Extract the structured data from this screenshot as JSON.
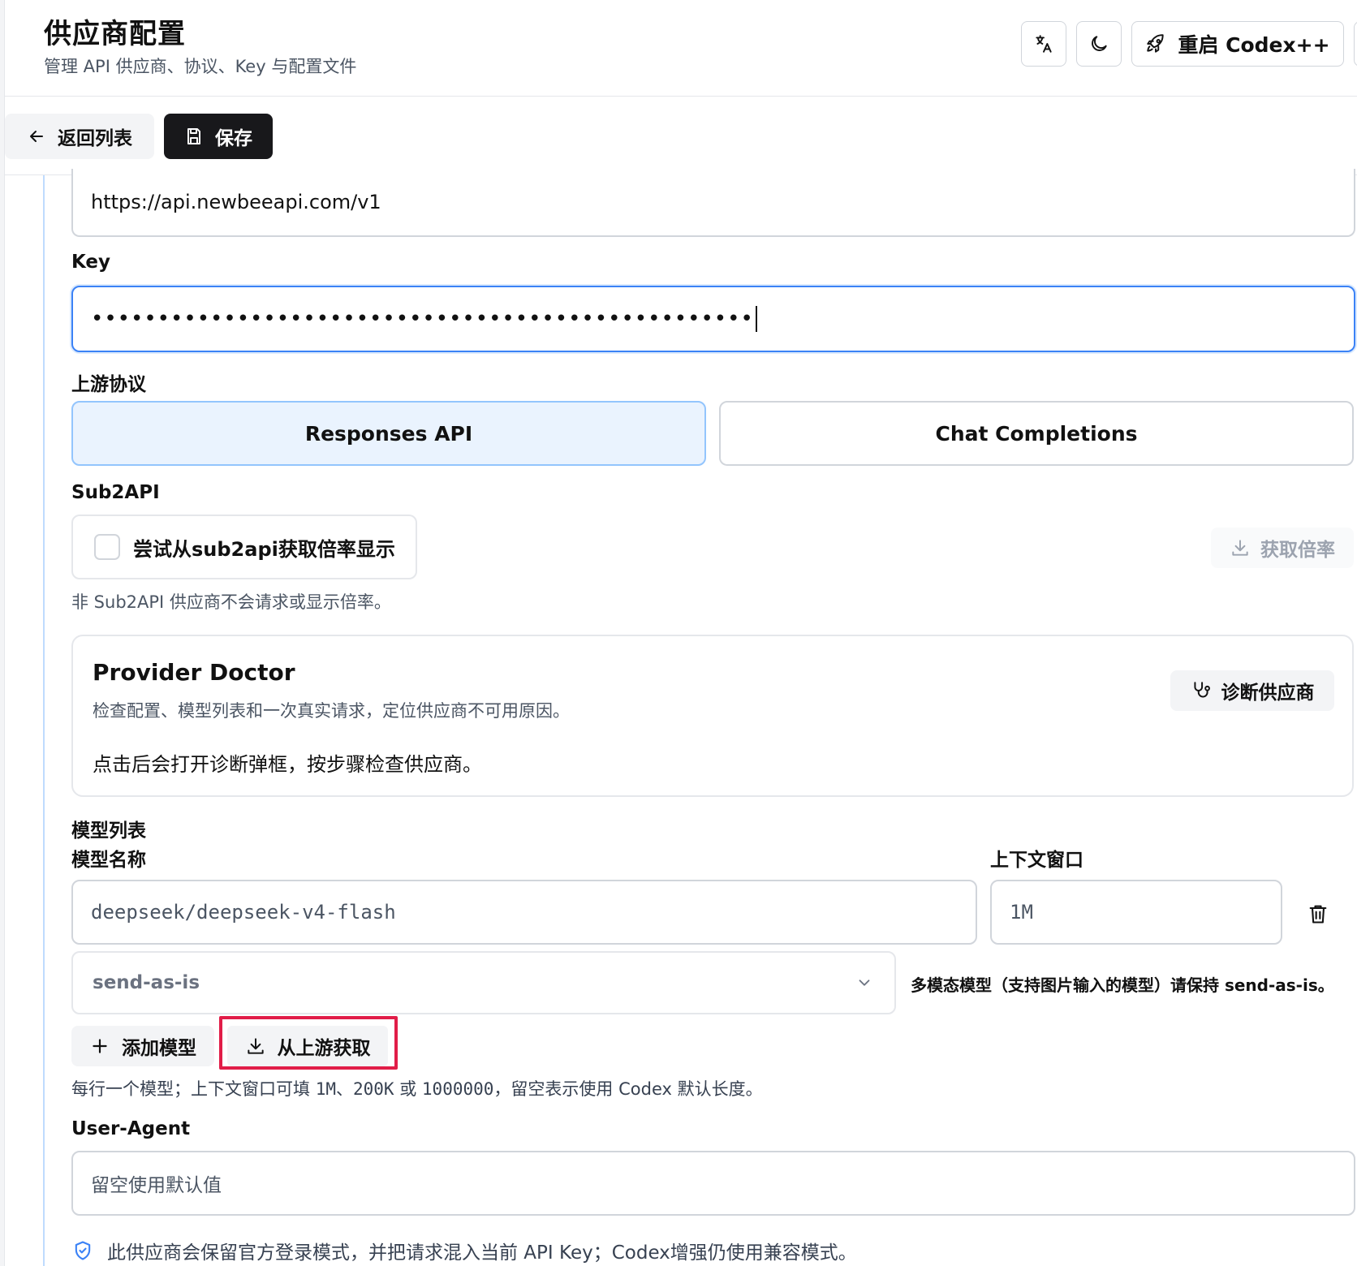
{
  "header": {
    "title": "供应商配置",
    "subtitle": "管理 API 供应商、协议、Key 与配置文件",
    "restart_label": "重启 Codex++"
  },
  "actions": {
    "back_label": "返回列表",
    "save_label": "保存"
  },
  "form": {
    "base_url_value": "https://api.newbeeapi.com/v1",
    "key_label": "Key",
    "key_value": "••••••••••••••••••••••••••••••••••••••••••••••••••",
    "protocol_label": "上游协议",
    "protocol_options": [
      "Responses API",
      "Chat Completions"
    ],
    "protocol_selected": "Responses API",
    "sub2api_label": "Sub2API",
    "sub2api_checkbox_label": "尝试从sub2api获取倍率显示",
    "sub2api_checked": false,
    "fetch_rate_label": "获取倍率",
    "sub2api_hint": "非 Sub2API 供应商不会请求或显示倍率。",
    "doctor": {
      "title": "Provider Doctor",
      "description": "检查配置、模型列表和一次真实请求，定位供应商不可用原因。",
      "note": "点击后会打开诊断弹框，按步骤检查供应商。",
      "button_label": "诊断供应商"
    },
    "models_label": "模型列表",
    "model_name_label": "模型名称",
    "context_window_label": "上下文窗口",
    "model_name_value": "deepseek/deepseek-v4-flash",
    "context_window_value": "1M",
    "mode_value": "send-as-is",
    "mode_hint": "多模态模型（支持图片输入的模型）请保持 send-as-is。",
    "add_model_label": "添加模型",
    "fetch_upstream_label": "从上游获取",
    "models_hint_a": "每行一个模型；上下文窗口可填 ",
    "models_hint_b": "1M、200K",
    "models_hint_c": " 或 ",
    "models_hint_d": "1000000",
    "models_hint_e": "，留空表示使用 Codex 默认长度。",
    "user_agent_label": "User-Agent",
    "user_agent_placeholder": "留空使用默认值",
    "footer_note": "此供应商会保留官方登录模式，并把请求混入当前 API Key；Codex增强仍使用兼容模式。"
  },
  "colors": {
    "accent_blue": "#3b82f6",
    "selected_bg": "#eaf3fe",
    "primary_dark": "#18181b",
    "highlight_red": "#e11d48"
  }
}
